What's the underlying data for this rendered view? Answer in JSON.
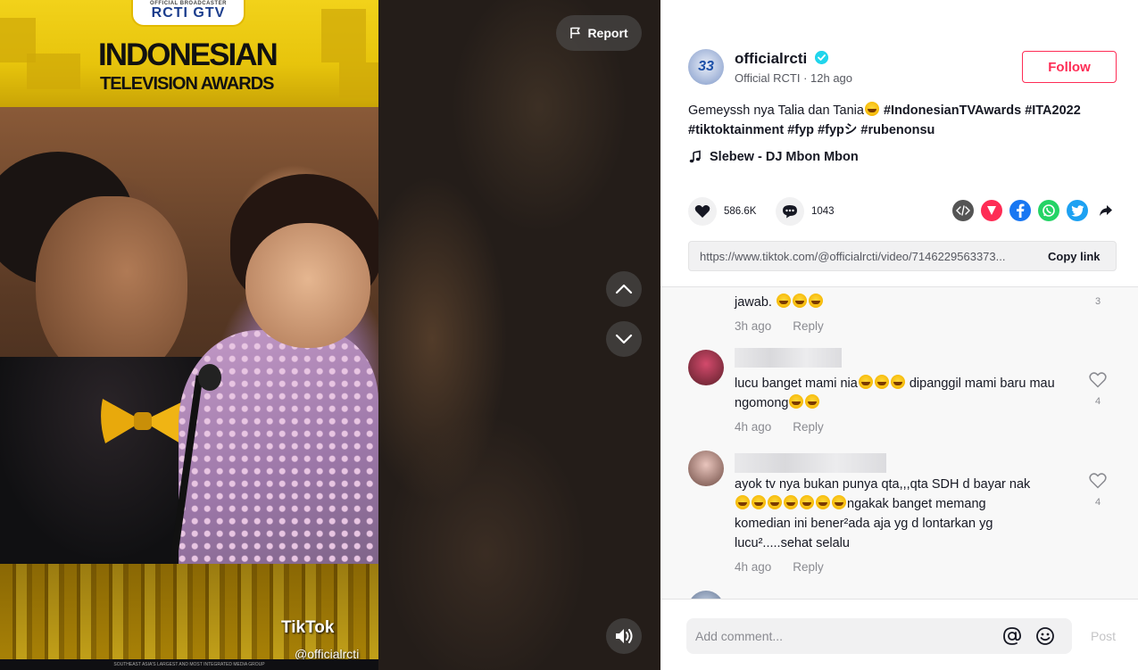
{
  "video": {
    "report_label": "Report",
    "overlay": {
      "broadcaster_small": "OFFICIAL BROADCASTER",
      "broadcaster_logos": "RCTI GTV",
      "ita_line1": "INDONESIAN",
      "ita_line2": "TELEVISION AWARDS",
      "watermark": "TikTok",
      "watermark_handle": "@officialrcti",
      "footer_text": "SOUTHEAST ASIA'S LARGEST AND MOST INTEGRATED MEDIA GROUP"
    },
    "controls": {
      "up": "chevron-up-icon",
      "down": "chevron-down-icon",
      "volume": "volume-icon"
    }
  },
  "author": {
    "avatar_text": "33",
    "username": "officialrcti",
    "display_name": "Official RCTI",
    "time_ago": "12h ago",
    "follow_label": "Follow"
  },
  "post": {
    "caption_text": "Gemeyssh nya Talia dan Tania",
    "hashtags": [
      "#IndonesianTVAwards",
      "#ITA2022",
      "#tiktoktainment",
      "#fyp",
      "#fypシ",
      "#rubenonsu"
    ],
    "music": "Slebew - DJ Mbon Mbon",
    "likes": "586.6K",
    "comments": "1043",
    "link_url": "https://www.tiktok.com/@officialrcti/video/7146229563373...",
    "copy_link_label": "Copy link"
  },
  "comments": [
    {
      "text": "jawab.",
      "emoji_count": 3,
      "time": "3h ago",
      "reply": "Reply",
      "likes": "3"
    },
    {
      "text_before": "lucu banget mami nia",
      "text_mid": " dipanggil mami baru mau ngomong",
      "time": "4h ago",
      "reply": "Reply",
      "likes": "4"
    },
    {
      "line1": "ayok tv nya bukan punya qta,,,qta SDH d bayar nak",
      "line2_after": "ngakak banget memang",
      "line3": "komedian ini bener²ada aja yg d lontarkan yg",
      "line4": "lucu².....sehat selalu",
      "time": "4h ago",
      "reply": "Reply",
      "likes": "4"
    }
  ],
  "comment_box": {
    "placeholder": "Add comment...",
    "post_label": "Post"
  },
  "colors": {
    "accent": "#fe2c55",
    "verified": "#20d5ec",
    "facebook": "#1877f2",
    "whatsapp": "#25d366",
    "twitter": "#1da1f2",
    "send": "#fe2c55"
  }
}
